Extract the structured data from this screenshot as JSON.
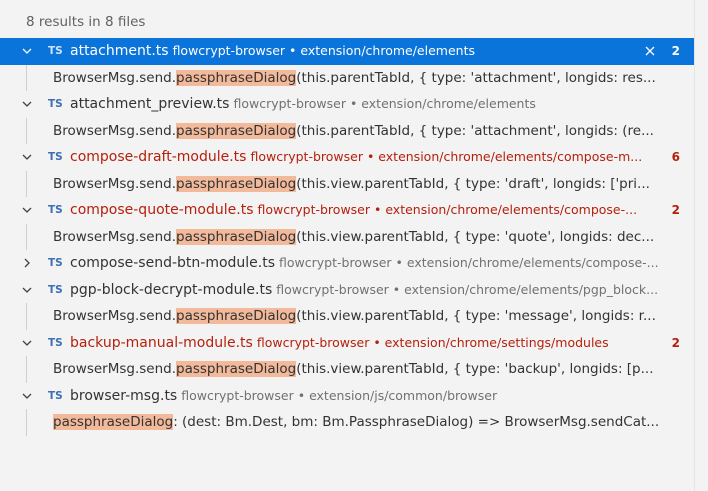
{
  "summary": "8 results in 8 files",
  "files": [
    {
      "name": "attachment.ts",
      "path": "flowcrypt-browser • extension/chrome/elements",
      "badge": "TS",
      "count": "2",
      "expanded": true,
      "selected": true,
      "modified": false,
      "match": {
        "prefix": "BrowserMsg.send.",
        "highlight": "passphraseDialog",
        "suffix": "(this.parentTabId, { type: 'attachment', longids: res..."
      }
    },
    {
      "name": "attachment_preview.ts",
      "path": "flowcrypt-browser • extension/chrome/elements",
      "badge": "TS",
      "count": "",
      "expanded": true,
      "selected": false,
      "modified": false,
      "match": {
        "prefix": "BrowserMsg.send.",
        "highlight": "passphraseDialog",
        "suffix": "(this.parentTabId, { type: 'attachment', longids: (re..."
      }
    },
    {
      "name": "compose-draft-module.ts",
      "path": "flowcrypt-browser • extension/chrome/elements/compose-m...",
      "badge": "TS",
      "count": "6",
      "expanded": true,
      "selected": false,
      "modified": true,
      "match": {
        "prefix": "BrowserMsg.send.",
        "highlight": "passphraseDialog",
        "suffix": "(this.view.parentTabId, { type: 'draft', longids: ['pri..."
      }
    },
    {
      "name": "compose-quote-module.ts",
      "path": "flowcrypt-browser • extension/chrome/elements/compose-...",
      "badge": "TS",
      "count": "2",
      "expanded": true,
      "selected": false,
      "modified": true,
      "match": {
        "prefix": "BrowserMsg.send.",
        "highlight": "passphraseDialog",
        "suffix": "(this.view.parentTabId, { type: 'quote', longids: dec..."
      }
    },
    {
      "name": "compose-send-btn-module.ts",
      "path": "flowcrypt-browser • extension/chrome/elements/compose-...",
      "badge": "TS",
      "count": "",
      "expanded": false,
      "selected": false,
      "modified": false,
      "match": null
    },
    {
      "name": "pgp-block-decrypt-module.ts",
      "path": "flowcrypt-browser • extension/chrome/elements/pgp_block...",
      "badge": "TS",
      "count": "",
      "expanded": true,
      "selected": false,
      "modified": false,
      "match": {
        "prefix": "BrowserMsg.send.",
        "highlight": "passphraseDialog",
        "suffix": "(this.view.parentTabId, { type: 'message', longids: r..."
      }
    },
    {
      "name": "backup-manual-module.ts",
      "path": "flowcrypt-browser • extension/chrome/settings/modules",
      "badge": "TS",
      "count": "2",
      "expanded": true,
      "selected": false,
      "modified": true,
      "match": {
        "prefix": "BrowserMsg.send.",
        "highlight": "passphraseDialog",
        "suffix": "(this.view.parentTabId, { type: 'backup', longids: [p..."
      }
    },
    {
      "name": "browser-msg.ts",
      "path": "flowcrypt-browser • extension/js/common/browser",
      "badge": "TS",
      "count": "",
      "expanded": true,
      "selected": false,
      "modified": false,
      "match": {
        "prefix": "",
        "highlight": "passphraseDialog",
        "suffix": ": (dest: Bm.Dest, bm: Bm.PassphraseDialog) => BrowserMsg.sendCat..."
      }
    }
  ],
  "icons": {
    "expanded": "chevron-down-icon",
    "collapsed": "chevron-right-icon",
    "dismiss": "close-icon"
  },
  "colors": {
    "selection": "#0a74db",
    "highlight": "#f2b99b",
    "modified": "#b5200d",
    "badge": "#3b6fb6"
  }
}
